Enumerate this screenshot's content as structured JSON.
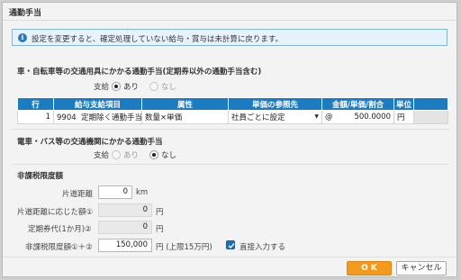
{
  "dialog": {
    "title": "通勤手当"
  },
  "info": {
    "message": "設定を変更すると、確定処理していない給与・賞与は未計算に戻ります。"
  },
  "section1": {
    "title": "車・自転車等の交通用具にかかる通勤手当(定期券以外の通勤手当含む)",
    "pay_label": "支給",
    "yes_label": "あり",
    "no_label": "なし",
    "selected": "あり"
  },
  "table": {
    "headers": [
      "行",
      "給与支給項目",
      "属性",
      "単価の参照先",
      "金額/単価/割合",
      "単位"
    ],
    "rows": [
      {
        "row": "1",
        "code": "9904",
        "item": "定期除く通勤手当",
        "attribute": "数量×単価",
        "reference": "社員ごとに設定",
        "at": "@",
        "amount": "500.0000",
        "unit": "円"
      }
    ]
  },
  "section2": {
    "title": "電車・バス等の交通機関にかかる通勤手当",
    "pay_label": "支給",
    "yes_label": "あり",
    "no_label": "なし",
    "selected": "なし"
  },
  "limit": {
    "title": "非課税限度額",
    "distance_label": "片道距離",
    "distance_value": "0",
    "distance_unit": "km",
    "amount1_label": "片道距離に応じた額①",
    "amount1_value": "0",
    "amount1_unit": "円",
    "amount2_label": "定期券代(1か月)②",
    "amount2_value": "0",
    "amount2_unit": "円",
    "total_label": "非課税限度額①＋②",
    "total_value": "150,000",
    "total_unit": "円 (上限15万円)",
    "direct_input_label": "直接入力する",
    "direct_input_checked": true
  },
  "buttons": {
    "ok": "O K",
    "cancel": "キャンセル"
  },
  "colors": {
    "header_blue": "#1c7cc2",
    "ok_orange": "#f39a1c",
    "info_bg": "#e7f3fb"
  }
}
